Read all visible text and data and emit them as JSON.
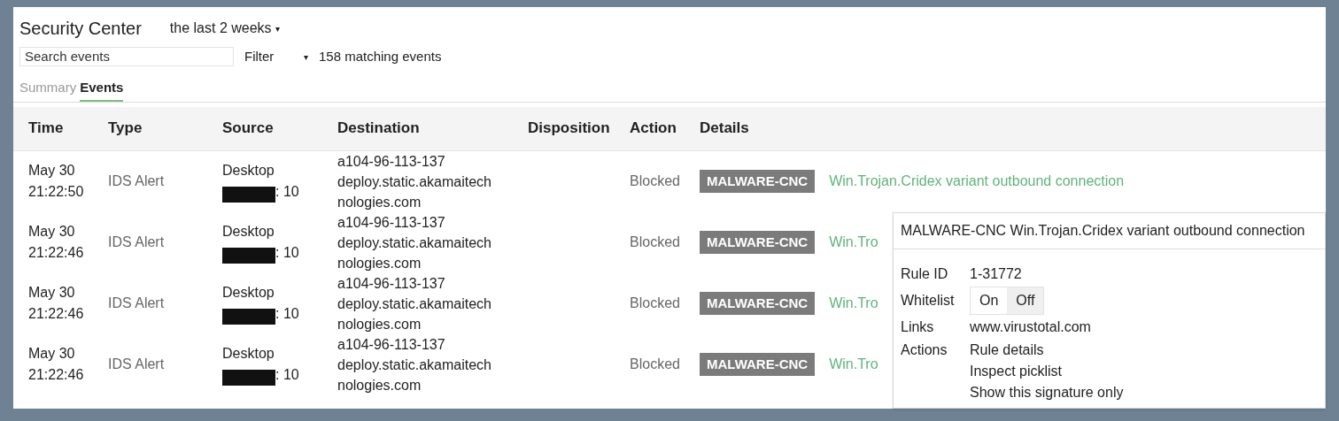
{
  "header": {
    "title": "Security Center",
    "range": "the last 2 weeks",
    "range_caret": "▾"
  },
  "toolbar": {
    "search": {
      "placeholder": "Search events"
    },
    "filter": "Filter",
    "filter_caret": "▾",
    "count": "158 matching events"
  },
  "tabs": [
    {
      "label": "Summary",
      "selected": false
    },
    {
      "label": "Events",
      "selected": true
    }
  ],
  "table": {
    "columns": [
      "Time",
      "Type",
      "Source",
      "Destination",
      "Disposition",
      "Action",
      "Details"
    ],
    "rows": [
      {
        "date": "May 30",
        "time": "21:22:50",
        "type": "IDS Alert",
        "source": "Desktop",
        "port": ": 10",
        "destination": [
          "a104-96-113-137",
          "deploy.static.akamaitech",
          "nologies.com"
        ],
        "action": "Blocked",
        "badge": "MALWARE-CNC",
        "details": "Win.Trojan.Cridex variant outbound connection"
      },
      {
        "date": "May 30",
        "time": "21:22:46",
        "type": "IDS Alert",
        "source": "Desktop",
        "port": ": 10",
        "destination": [
          "a104-96-113-137",
          "deploy.static.akamaitech",
          "nologies.com"
        ],
        "action": "Blocked",
        "badge": "MALWARE-CNC",
        "details": "Win.Tro"
      },
      {
        "date": "May 30",
        "time": "21:22:46",
        "type": "IDS Alert",
        "source": "Desktop",
        "port": ": 10",
        "destination": [
          "a104-96-113-137",
          "deploy.static.akamaitech",
          "nologies.com"
        ],
        "action": "Blocked",
        "badge": "MALWARE-CNC",
        "details": "Win.Tro"
      },
      {
        "date": "May 30",
        "time": "21:22:46",
        "type": "IDS Alert",
        "source": "Desktop",
        "port": ": 10",
        "destination": [
          "a104-96-113-137",
          "deploy.static.akamaitech",
          "nologies.com"
        ],
        "action": "Blocked",
        "badge": "MALWARE-CNC",
        "details": "Win.Tro"
      }
    ]
  },
  "popup": {
    "title": "MALWARE-CNC Win.Trojan.Cridex variant outbound connection",
    "rule_id_label": "Rule ID",
    "rule_id": "1-31772",
    "whitelist_label": "Whitelist",
    "whitelist_options": [
      {
        "label": "On",
        "selected": false
      },
      {
        "label": "Off",
        "selected": true
      }
    ],
    "links_label": "Links",
    "links": [
      "www.virustotal.com"
    ],
    "actions_label": "Actions",
    "actions": [
      "Rule details",
      "Inspect picklist",
      "Show this signature only"
    ]
  }
}
